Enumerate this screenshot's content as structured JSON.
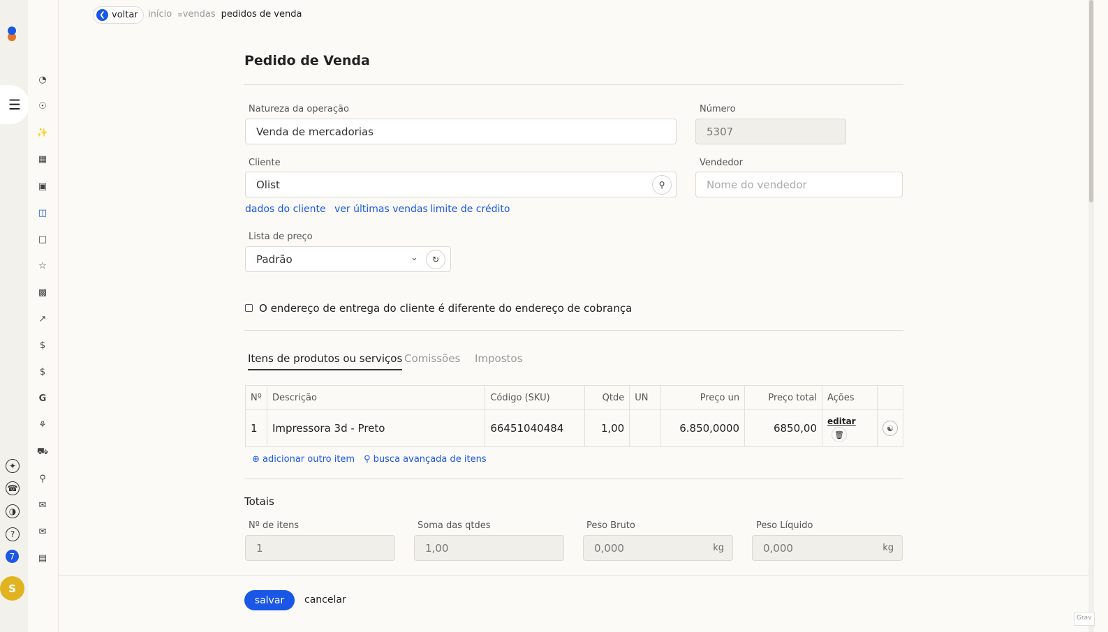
{
  "sidebar": {
    "menu_icon": "hamburger-icon",
    "bottom_badge": "7",
    "avatar_initial": "S",
    "nav_icons": [
      "dashboard-icon",
      "eye-icon",
      "magic-wand-icon",
      "catalog-icon",
      "briefcase-icon",
      "inbox-icon",
      "document-icon",
      "star-icon",
      "qr-code-icon",
      "chart-icon",
      "dollar-icon",
      "dollar-icon",
      "google-icon",
      "network-icon",
      "truck-icon",
      "cart-icon",
      "chat-icon",
      "message-icon",
      "report-icon"
    ]
  },
  "breadcrumb": {
    "back_label": "voltar",
    "items": [
      "início",
      "vendas",
      "pedidos de venda"
    ]
  },
  "page": {
    "title": "Pedido de Venda"
  },
  "form": {
    "natureza_label": "Natureza da operação",
    "natureza_value": "Venda de mercadorias",
    "numero_label": "Número",
    "numero_value": "5307",
    "cliente_label": "Cliente",
    "cliente_value": "Olist",
    "vendedor_label": "Vendedor",
    "vendedor_placeholder": "Nome do vendedor",
    "links": {
      "dados_cliente": "dados do cliente",
      "ultimas_vendas": "ver últimas vendas",
      "limite_credito": "limite de crédito"
    },
    "lista_preco_label": "Lista de preço",
    "lista_preco_value": "Padrão",
    "endereco_checkbox": "O endereço de entrega do cliente é diferente do endereço de cobrança"
  },
  "tabs": [
    "Itens de produtos ou serviços",
    "Comissões",
    "Impostos"
  ],
  "items_table": {
    "headers": [
      "Nº",
      "Descrição",
      "Código (SKU)",
      "Qtde",
      "UN",
      "Preço un",
      "Preço total",
      "Ações"
    ],
    "rows": [
      {
        "n": "1",
        "descricao": "Impressora 3d - Preto",
        "sku": "66451040484",
        "qtde": "1,00",
        "un": "",
        "preco_un": "6.850,0000",
        "preco_total": "6850,00",
        "edit": "editar"
      }
    ],
    "add_item": "adicionar outro item",
    "advanced_search": "busca avançada de itens"
  },
  "totais": {
    "title": "Totais",
    "n_itens_label": "Nº de itens",
    "n_itens_value": "1",
    "soma_qtdes_label": "Soma das qtdes",
    "soma_qtdes_value": "1,00",
    "peso_bruto_label": "Peso Bruto",
    "peso_bruto_value": "0,000",
    "peso_liquido_label": "Peso Líquido",
    "peso_liquido_value": "0,000",
    "unit": "kg"
  },
  "footer": {
    "save": "salvar",
    "cancel": "cancelar"
  },
  "colors": {
    "accent": "#1a57e6",
    "avatar": "#e2b320"
  }
}
